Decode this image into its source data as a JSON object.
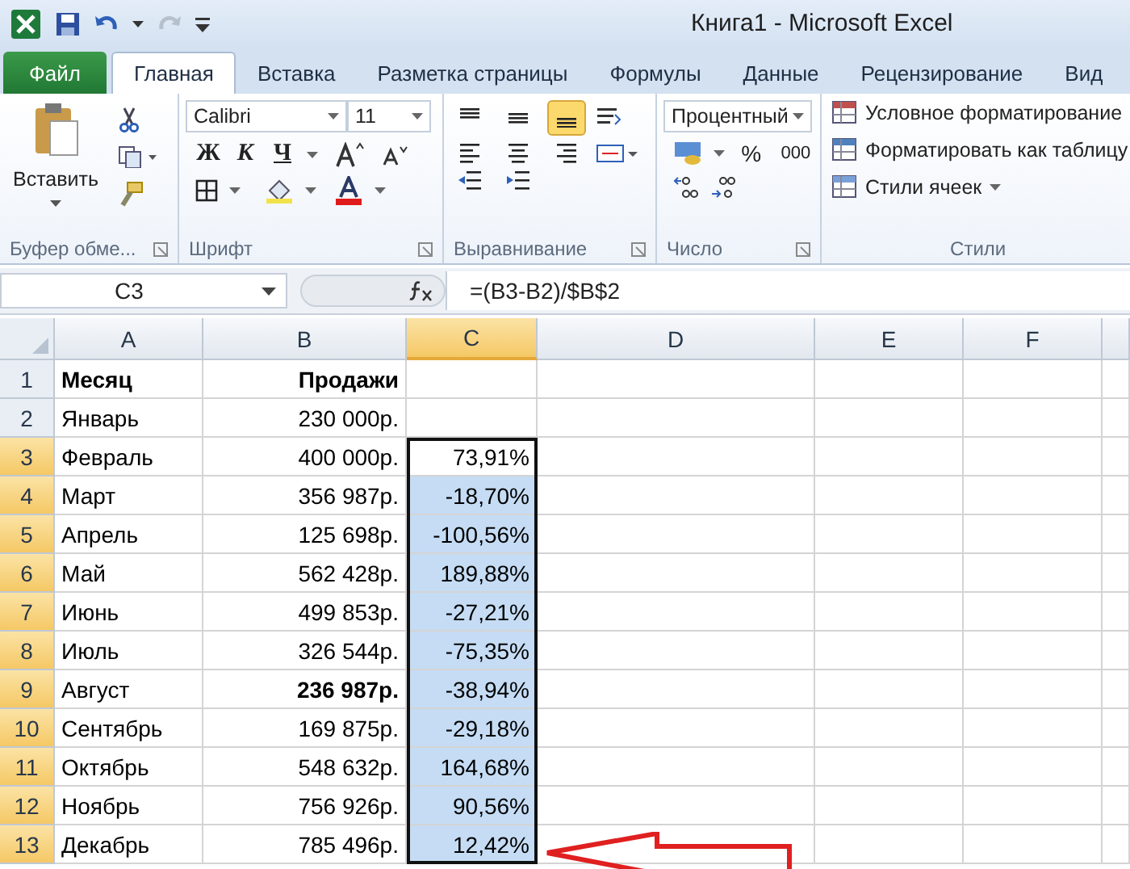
{
  "window": {
    "title": "Книга1  -  Microsoft Excel"
  },
  "tabs": [
    {
      "label": "Файл",
      "kind": "file",
      "selected": false
    },
    {
      "label": "Главная",
      "kind": "tab",
      "selected": true
    },
    {
      "label": "Вставка",
      "kind": "tab",
      "selected": false
    },
    {
      "label": "Разметка страницы",
      "kind": "tab",
      "selected": false
    },
    {
      "label": "Формулы",
      "kind": "tab",
      "selected": false
    },
    {
      "label": "Данные",
      "kind": "tab",
      "selected": false
    },
    {
      "label": "Рецензирование",
      "kind": "tab",
      "selected": false
    },
    {
      "label": "Вид",
      "kind": "tab",
      "selected": false
    }
  ],
  "ribbon": {
    "clipboard": {
      "paste": "Вставить",
      "group": "Буфер обме..."
    },
    "font": {
      "name": "Calibri",
      "size": "11",
      "bold": "Ж",
      "italic": "К",
      "underline": "Ч",
      "group": "Шрифт"
    },
    "alignment": {
      "vertical": [
        {
          "selected": false
        },
        {
          "selected": false
        },
        {
          "selected": true
        }
      ],
      "group": "Выравнивание"
    },
    "number": {
      "format": "Процентный",
      "percent": "%",
      "thousands": "000",
      "group": "Число"
    },
    "styles": {
      "items": [
        "Условное форматирование",
        "Форматировать как таблицу",
        "Стили ячеек"
      ],
      "group": "Стили"
    }
  },
  "formula_bar": {
    "name_box": "C3",
    "formula": "=(B3-B2)/$B$2"
  },
  "grid": {
    "columns": [
      {
        "label": "A",
        "selected": false
      },
      {
        "label": "B",
        "selected": false
      },
      {
        "label": "C",
        "selected": true
      },
      {
        "label": "D",
        "selected": false
      },
      {
        "label": "E",
        "selected": false
      },
      {
        "label": "F",
        "selected": false
      }
    ],
    "rows": [
      {
        "header": "1",
        "selected": false,
        "cells": [
          {
            "text": "Месяц",
            "bold": true,
            "selected": false
          },
          {
            "text": "Продажи",
            "bold": true,
            "selected": false
          }
        ]
      },
      {
        "header": "2",
        "selected": false,
        "cells": [
          {
            "text": "Январь",
            "bold": false,
            "selected": false
          },
          {
            "text": "230 000р.",
            "bold": false,
            "selected": false
          }
        ]
      },
      {
        "header": "3",
        "selected": true,
        "cells": [
          {
            "text": "Февраль",
            "bold": false,
            "selected": false
          },
          {
            "text": "400 000р.",
            "bold": false,
            "selected": false
          },
          {
            "text": "73,91%",
            "bold": false,
            "selected": true
          }
        ]
      },
      {
        "header": "4",
        "selected": true,
        "cells": [
          {
            "text": "Март",
            "bold": false,
            "selected": false
          },
          {
            "text": "356 987р.",
            "bold": false,
            "selected": false
          },
          {
            "text": "-18,70%",
            "bold": false,
            "selected": true
          }
        ]
      },
      {
        "header": "5",
        "selected": true,
        "cells": [
          {
            "text": "Апрель",
            "bold": false,
            "selected": false
          },
          {
            "text": "125 698р.",
            "bold": false,
            "selected": false
          },
          {
            "text": "-100,56%",
            "bold": false,
            "selected": true
          }
        ]
      },
      {
        "header": "6",
        "selected": true,
        "cells": [
          {
            "text": "Май",
            "bold": false,
            "selected": false
          },
          {
            "text": "562 428р.",
            "bold": false,
            "selected": false
          },
          {
            "text": "189,88%",
            "bold": false,
            "selected": true
          }
        ]
      },
      {
        "header": "7",
        "selected": true,
        "cells": [
          {
            "text": "Июнь",
            "bold": false,
            "selected": false
          },
          {
            "text": "499 853р.",
            "bold": false,
            "selected": false
          },
          {
            "text": "-27,21%",
            "bold": false,
            "selected": true
          }
        ]
      },
      {
        "header": "8",
        "selected": true,
        "cells": [
          {
            "text": "Июль",
            "bold": false,
            "selected": false
          },
          {
            "text": "326 544р.",
            "bold": false,
            "selected": false
          },
          {
            "text": "-75,35%",
            "bold": false,
            "selected": true
          }
        ]
      },
      {
        "header": "9",
        "selected": true,
        "cells": [
          {
            "text": "Август",
            "bold": false,
            "selected": false
          },
          {
            "text": "236 987р.",
            "bold": true,
            "selected": false
          },
          {
            "text": "-38,94%",
            "bold": false,
            "selected": true
          }
        ]
      },
      {
        "header": "10",
        "selected": true,
        "cells": [
          {
            "text": "Сентябрь",
            "bold": false,
            "selected": false
          },
          {
            "text": "169 875р.",
            "bold": false,
            "selected": false
          },
          {
            "text": "-29,18%",
            "bold": false,
            "selected": true
          }
        ]
      },
      {
        "header": "11",
        "selected": true,
        "cells": [
          {
            "text": "Октябрь",
            "bold": false,
            "selected": false
          },
          {
            "text": "548 632р.",
            "bold": false,
            "selected": false
          },
          {
            "text": "164,68%",
            "bold": false,
            "selected": true
          }
        ]
      },
      {
        "header": "12",
        "selected": true,
        "cells": [
          {
            "text": "Ноябрь",
            "bold": false,
            "selected": false
          },
          {
            "text": "756 926р.",
            "bold": false,
            "selected": false
          },
          {
            "text": "90,56%",
            "bold": false,
            "selected": true
          }
        ]
      },
      {
        "header": "13",
        "selected": true,
        "cells": [
          {
            "text": "Декабрь",
            "bold": false,
            "selected": false
          },
          {
            "text": "785 496р.",
            "bold": false,
            "selected": false
          },
          {
            "text": "12,42%",
            "bold": false,
            "selected": true
          }
        ]
      }
    ]
  }
}
